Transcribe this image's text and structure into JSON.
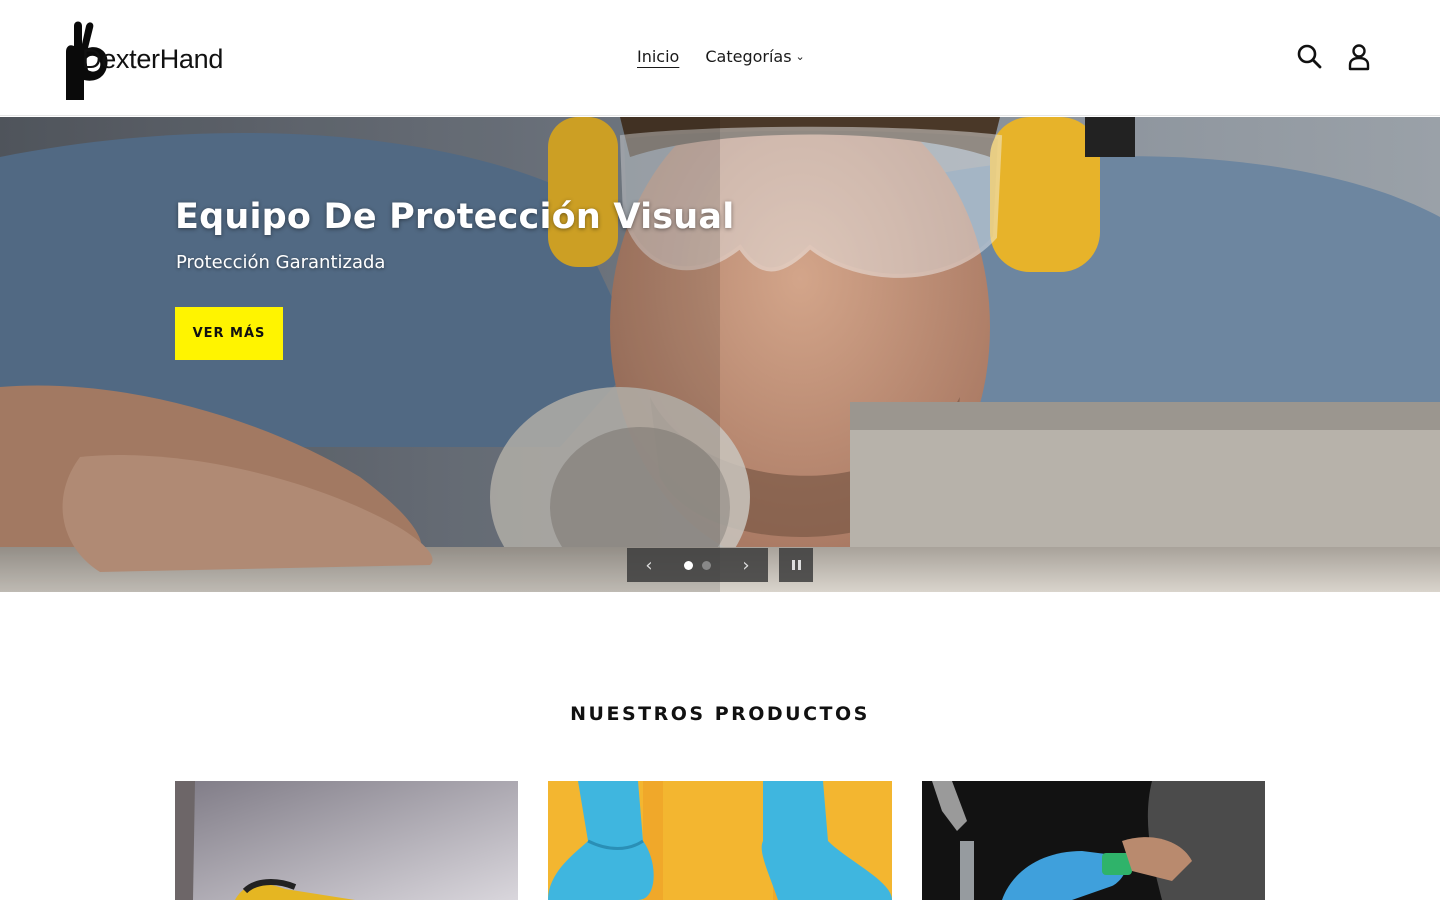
{
  "brand": {
    "name": "DexterHand",
    "logo_icon": "ok-hand-icon"
  },
  "nav": {
    "items": [
      {
        "label": "Inicio",
        "active": true
      },
      {
        "label": "Categorías",
        "active": false,
        "has_dropdown": true
      }
    ]
  },
  "header_icons": {
    "search": "search-icon",
    "account": "account-icon"
  },
  "hero": {
    "title": "Equipo De Protección Visual",
    "subtitle": "Protección Garantizada",
    "cta_label": "VER MÁS",
    "cta_color": "#fff400",
    "slides_total": 2,
    "slide_current": 1,
    "prev_icon": "chevron-left-icon",
    "next_icon": "chevron-right-icon",
    "pause_icon": "pause-icon"
  },
  "products_section": {
    "title": "NUESTROS PRODUCTOS",
    "products": [
      {
        "image": "glove-work-photo"
      },
      {
        "image": "blue-gloves-yellow-photo"
      },
      {
        "image": "blue-glove-faucet-photo"
      }
    ]
  }
}
